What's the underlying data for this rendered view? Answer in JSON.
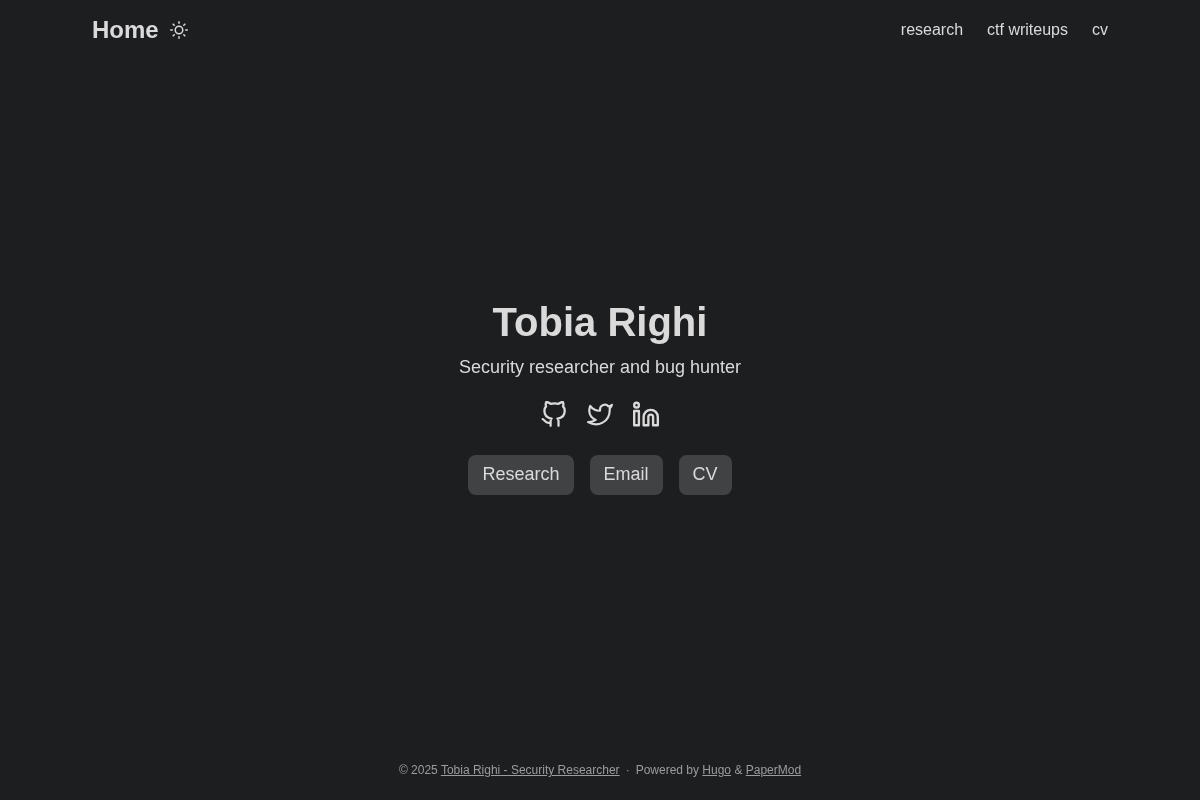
{
  "header": {
    "logo": "Home",
    "nav": [
      {
        "label": "research"
      },
      {
        "label": "ctf writeups"
      },
      {
        "label": "cv"
      }
    ]
  },
  "profile": {
    "name": "Tobia Righi",
    "subtitle": "Security researcher and bug hunter",
    "buttons": [
      "Research",
      "Email",
      "CV"
    ]
  },
  "footer": {
    "copyright": [
      {
        "kind": "text",
        "text": "© 2025"
      },
      {
        "kind": "link",
        "text": "Tobia Righi - Security Researcher"
      }
    ],
    "separator": "·",
    "powered": [
      {
        "kind": "text",
        "text": "Powered by"
      },
      {
        "kind": "link",
        "text": "Hugo"
      },
      {
        "kind": "text",
        "text": "&"
      },
      {
        "kind": "link",
        "text": "PaperMod"
      }
    ]
  }
}
